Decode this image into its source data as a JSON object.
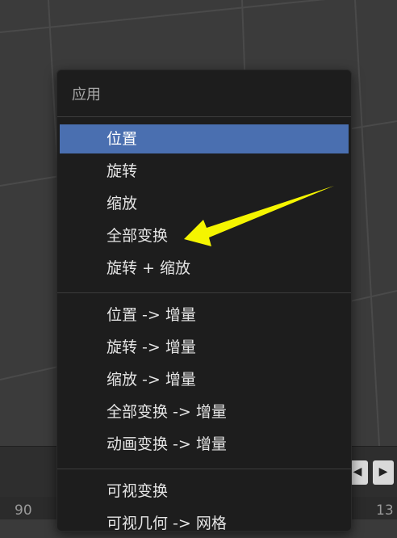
{
  "menu": {
    "header": "应用",
    "groups": [
      [
        "位置",
        "旋转",
        "缩放",
        "全部变换",
        "旋转 + 缩放"
      ],
      [
        "位置 -> 增量",
        "旋转 -> 增量",
        "缩放 -> 增量",
        "全部变换 -> 增量",
        "动画变换 -> 增量"
      ],
      [
        "可视变换",
        "可视几何 -> 网格"
      ]
    ],
    "highlighted_item": "位置"
  },
  "timeline": {
    "left_frame": "90",
    "right_frame": "13"
  },
  "colors": {
    "menu_bg": "#1d1d1d",
    "highlight": "#4a6fb0",
    "annotation_arrow": "#f5f500"
  }
}
